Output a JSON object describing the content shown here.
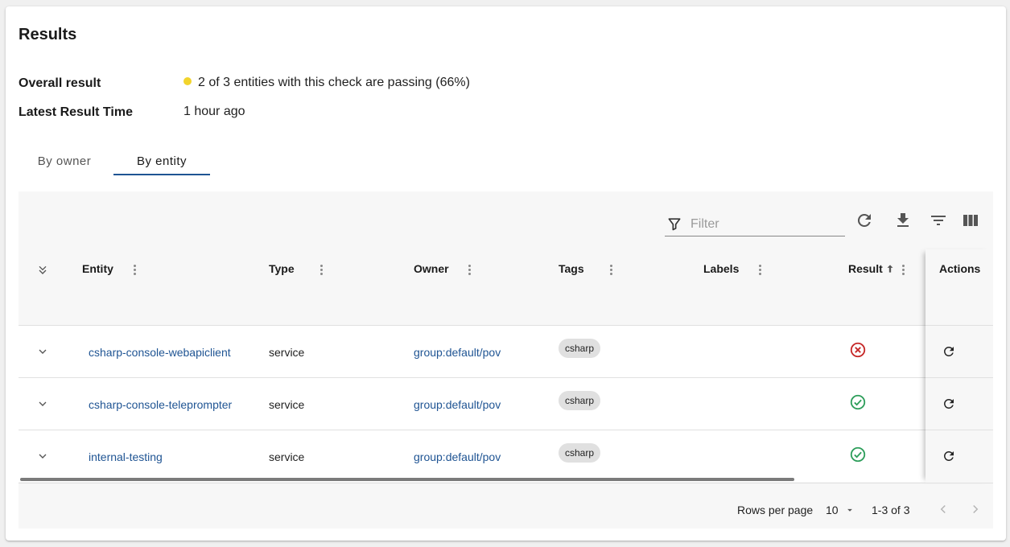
{
  "card": {
    "title": "Results",
    "overall_result_label": "Overall result",
    "overall_result_value": "2 of 3 entities with this check are passing (66%)",
    "status_color": "#f2d42c",
    "latest_result_label": "Latest Result Time",
    "latest_result_value": "1 hour ago"
  },
  "tabs": [
    {
      "label": "By owner",
      "selected": false
    },
    {
      "label": "By entity",
      "selected": true
    }
  ],
  "toolbar": {
    "filter_placeholder": "Filter",
    "icons": [
      "filter-icon",
      "refresh-icon",
      "download-icon",
      "filter-list-icon",
      "view-columns-icon"
    ]
  },
  "table": {
    "headers": {
      "entity": "Entity",
      "type": "Type",
      "owner": "Owner",
      "tags": "Tags",
      "labels": "Labels",
      "result": "Result",
      "actions": "Actions"
    },
    "rows": [
      {
        "entity": "csharp-console-webapiclient",
        "type": "service",
        "owner": "group:default/pov",
        "tag": "csharp",
        "result": "failed"
      },
      {
        "entity": "csharp-console-teleprompter",
        "type": "service",
        "owner": "group:default/pov",
        "tag": "csharp",
        "result": "passed"
      },
      {
        "entity": "internal-testing",
        "type": "service",
        "owner": "group:default/pov",
        "tag": "csharp",
        "result": "passed"
      }
    ]
  },
  "pagination": {
    "rows_per_page_label": "Rows per page",
    "rows_per_page_value": "10",
    "range": "1-3 of 3"
  },
  "colors": {
    "accent": "#1f5493",
    "fail": "#c62828",
    "pass": "#2e9e5b"
  }
}
